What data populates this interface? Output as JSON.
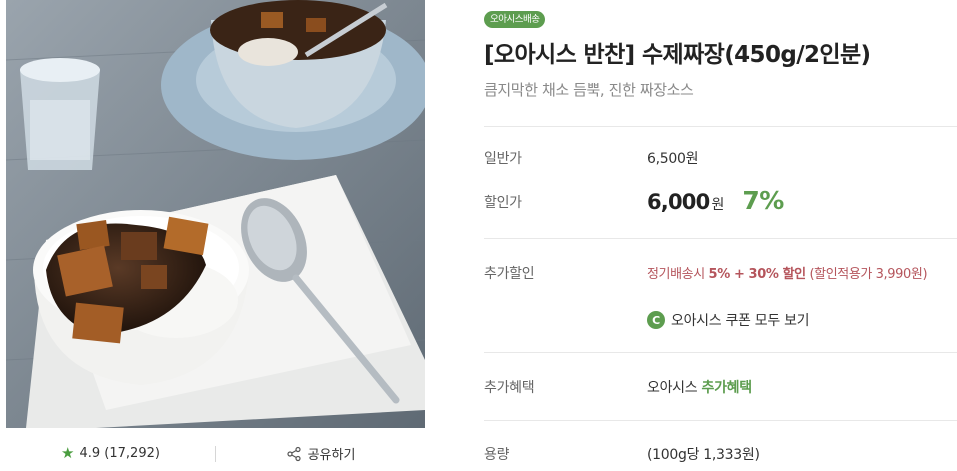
{
  "product": {
    "badge": "오아시스배송",
    "title": "[오아시스 반찬] 수제짜장(450g/2인분)",
    "subtitle": "큼지막한 채소 듬뿍, 진한 짜장소스"
  },
  "image": {
    "alt": "jjajang rice bowl with spoon on white board",
    "rating_icon": "star-icon",
    "rating": "4.9 (17,292)",
    "share_icon": "share-icon",
    "share_label": "공유하기"
  },
  "pricing": {
    "regular_label": "일반가",
    "regular_value": "6,500원",
    "sale_label": "할인가",
    "sale_amount": "6,000",
    "sale_unit": "원",
    "discount_rate": "7%"
  },
  "extra_discount": {
    "label": "추가할인",
    "prefix": "정기배송시 ",
    "highlight": "5% + 30% 할인",
    "suffix": " (할인적용가 3,990원)",
    "coupon_icon": "C",
    "coupon_label": "오아시스 쿠폰 모두 보기"
  },
  "benefit": {
    "label": "추가혜택",
    "value_prefix": "오아시스 ",
    "value_highlight": "추가혜택"
  },
  "capacity": {
    "label": "용량",
    "value": "(100g당 1,333원)"
  },
  "colors": {
    "accent_green": "#5d9d4f",
    "discount_red": "#b5555c"
  }
}
